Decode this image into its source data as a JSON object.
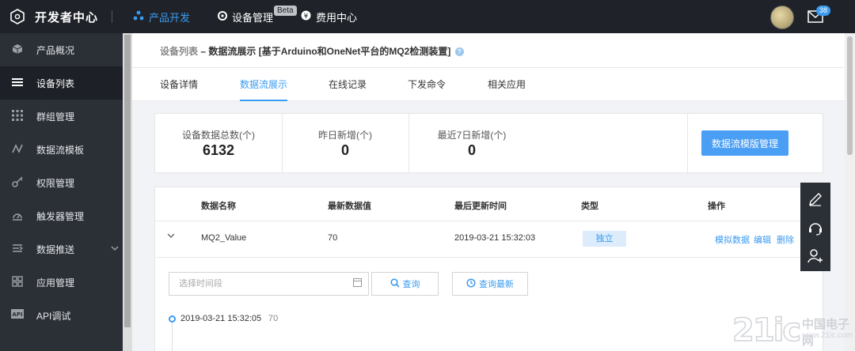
{
  "header": {
    "logo_text": "开发者中心",
    "nav": [
      {
        "label": "产品开发",
        "active": true
      },
      {
        "label": "设备管理",
        "badge": "Beta"
      },
      {
        "label": "费用中心"
      }
    ],
    "mail_count": "38"
  },
  "sidebar": {
    "items": [
      {
        "label": "产品概况",
        "icon": "cube-icon"
      },
      {
        "label": "设备列表",
        "icon": "list-icon",
        "active": true
      },
      {
        "label": "群组管理",
        "icon": "grid-dots-icon"
      },
      {
        "label": "数据流模板",
        "icon": "datastream-icon"
      },
      {
        "label": "权限管理",
        "icon": "key-icon"
      },
      {
        "label": "触发器管理",
        "icon": "trigger-icon"
      },
      {
        "label": "数据推送",
        "icon": "push-icon"
      },
      {
        "label": "应用管理",
        "icon": "apps-icon"
      },
      {
        "label": "API调试",
        "icon": "api-icon"
      }
    ]
  },
  "breadcrumb": {
    "parent": "设备列表",
    "separator": " – ",
    "current": "数据流展示 [基于Arduino和OneNet平台的MQ2检测装置]"
  },
  "tabs": [
    "设备详情",
    "数据流展示",
    "在线记录",
    "下发命令",
    "相关应用"
  ],
  "stats": {
    "total_label": "设备数据总数(个)",
    "total_value": "6132",
    "yesterday_label": "昨日新增(个)",
    "yesterday_value": "0",
    "week_label": "最近7日新增(个)",
    "week_value": "0",
    "manage_button": "数据流模版管理"
  },
  "table": {
    "headers": [
      "数据名称",
      "最新数据值",
      "最后更新时间",
      "类型",
      "操作"
    ],
    "row": {
      "name": "MQ2_Value",
      "value": "70",
      "updated": "2019-03-21 15:32:03",
      "type": "独立",
      "actions": [
        "模拟数据",
        "编辑",
        "删除"
      ]
    }
  },
  "filter": {
    "date_placeholder": "选择时间段",
    "query_button": "查询",
    "query_latest_button": "查询最新"
  },
  "timeline": [
    {
      "time": "2019-03-21 15:32:05",
      "value": "70"
    }
  ],
  "watermark": {
    "main": "21ic",
    "sub": "中国电子网",
    "url": "www.21ic.com"
  }
}
